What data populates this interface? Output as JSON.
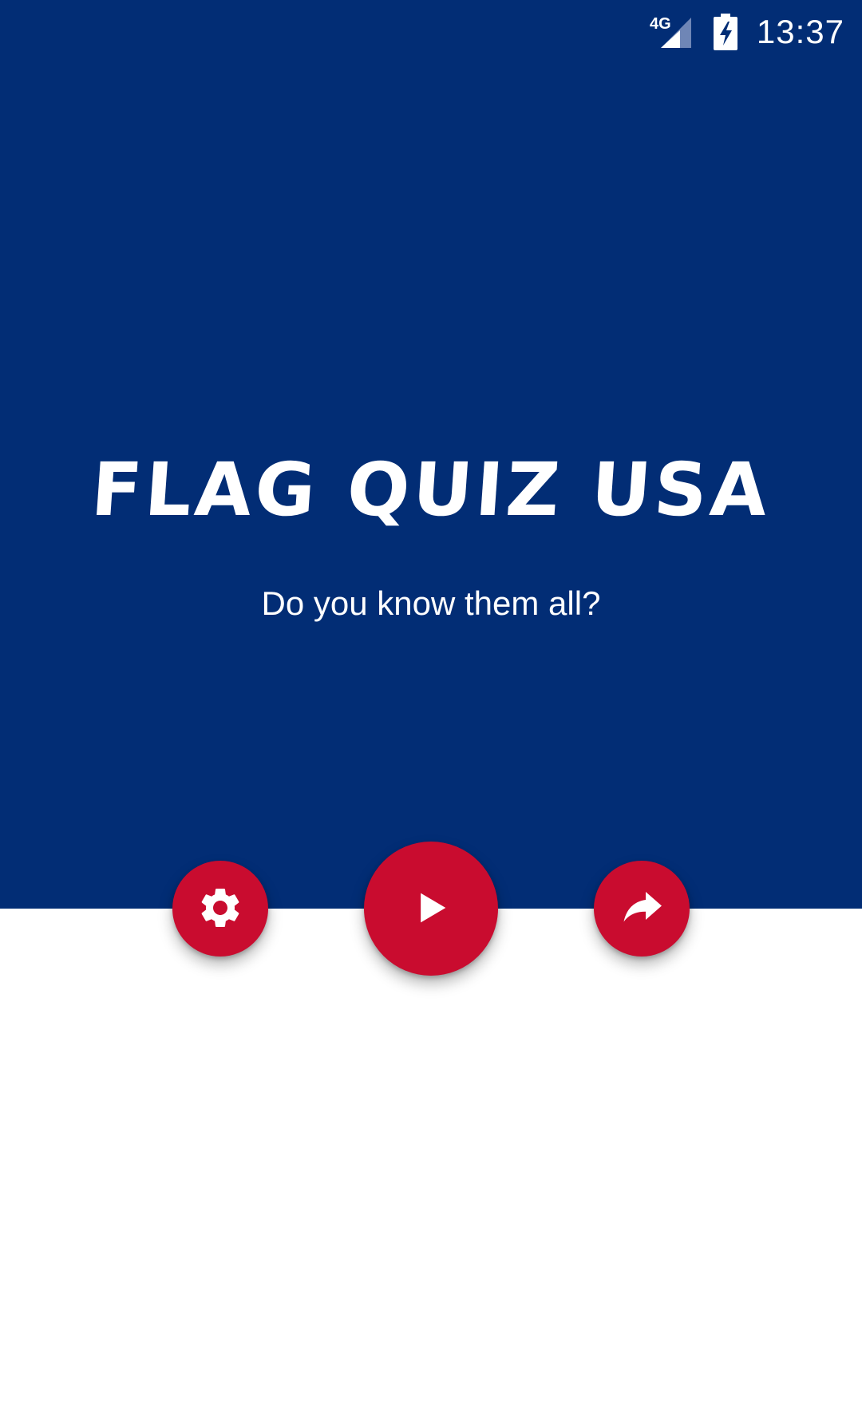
{
  "status_bar": {
    "network": "4G",
    "time": "13:37"
  },
  "main": {
    "title": "FLAG QUIZ USA",
    "subtitle": "Do you know them all?"
  },
  "actions": {
    "settings_icon": "gear-icon",
    "play_icon": "play-icon",
    "share_icon": "share-icon"
  },
  "colors": {
    "primary": "#022d75",
    "accent": "#c90c2f",
    "background": "#ffffff"
  }
}
